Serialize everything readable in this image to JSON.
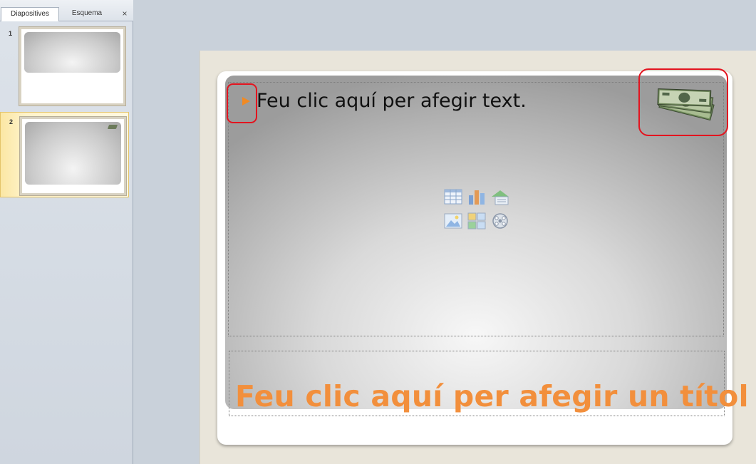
{
  "panel": {
    "tabs": [
      {
        "label": "Diapositives",
        "selected": true
      },
      {
        "label": "Esquema",
        "selected": false
      }
    ],
    "close_symbol": "×",
    "thumbnails": [
      {
        "number": "1",
        "selected": false
      },
      {
        "number": "2",
        "selected": true,
        "has_money_icon": true
      }
    ]
  },
  "slide": {
    "body_placeholder_text": "Feu clic aquí per afegir text.",
    "title_placeholder_text": "Feu clic aquí per afegir un títol",
    "bullet_color": "#f08a24",
    "title_color": "#f28f3c",
    "insert_icons": [
      "insert-table-icon",
      "insert-chart-icon",
      "insert-smartart-icon",
      "insert-picture-icon",
      "insert-clipart-icon",
      "insert-media-icon"
    ],
    "image": "money-bills-icon"
  },
  "annotations": {
    "highlight_color": "#e3141f",
    "highlights": [
      "bullet-highlight",
      "picture-highlight"
    ]
  }
}
